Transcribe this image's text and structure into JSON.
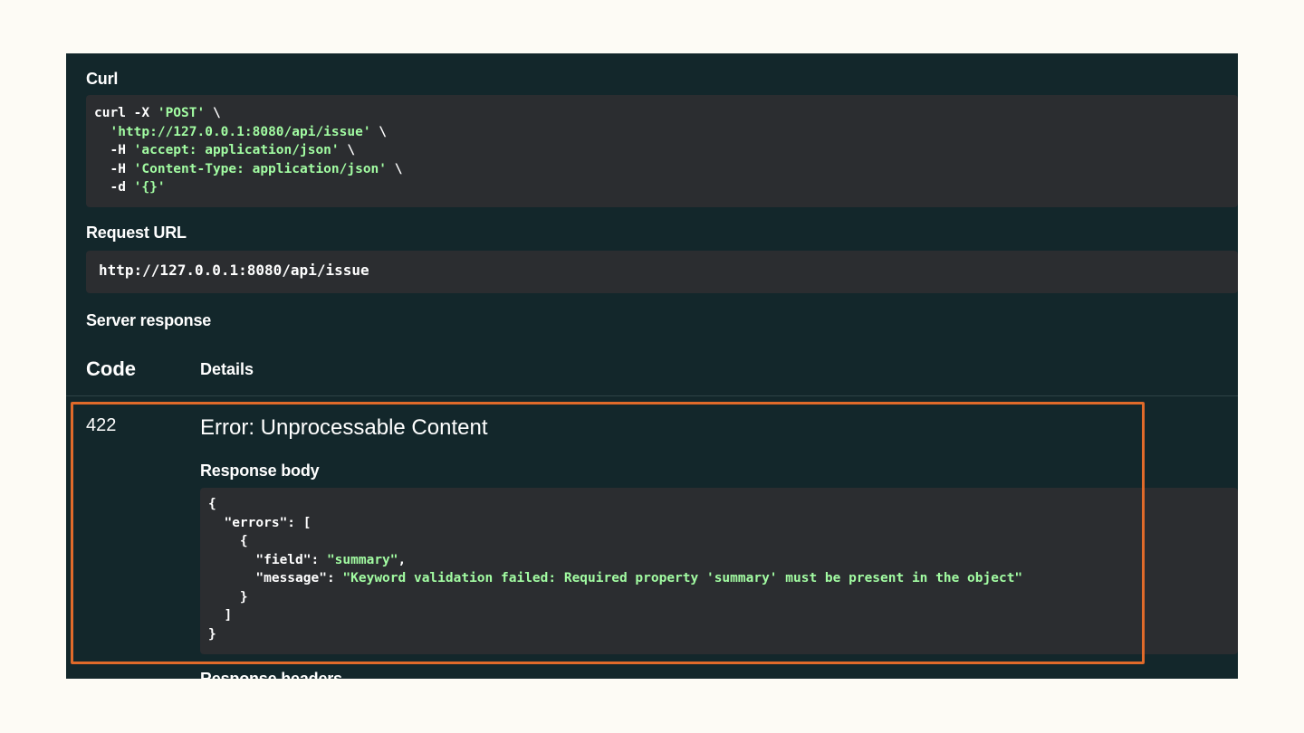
{
  "curl": {
    "label": "Curl",
    "lines": [
      [
        {
          "t": "curl -X ",
          "s": false
        },
        {
          "t": "'POST'",
          "s": true
        },
        {
          "t": " \\",
          "s": false
        }
      ],
      [
        {
          "t": "  ",
          "s": false
        },
        {
          "t": "'http://127.0.0.1:8080/api/issue'",
          "s": true
        },
        {
          "t": " \\",
          "s": false
        }
      ],
      [
        {
          "t": "  -H ",
          "s": false
        },
        {
          "t": "'accept: application/json'",
          "s": true
        },
        {
          "t": " \\",
          "s": false
        }
      ],
      [
        {
          "t": "  -H ",
          "s": false
        },
        {
          "t": "'Content-Type: application/json'",
          "s": true
        },
        {
          "t": " \\",
          "s": false
        }
      ],
      [
        {
          "t": "  -d ",
          "s": false
        },
        {
          "t": "'{}'",
          "s": true
        }
      ]
    ]
  },
  "request_url": {
    "label": "Request URL",
    "value": "http://127.0.0.1:8080/api/issue"
  },
  "server_response": {
    "label": "Server response",
    "col_code": "Code",
    "col_details": "Details",
    "code": "422",
    "title": "Error: Unprocessable Content",
    "body_label": "Response body",
    "body_lines": [
      [
        {
          "t": "{",
          "s": false
        }
      ],
      [
        {
          "t": "  \"errors\": [",
          "s": false
        }
      ],
      [
        {
          "t": "    {",
          "s": false
        }
      ],
      [
        {
          "t": "      \"field\": ",
          "s": false
        },
        {
          "t": "\"summary\"",
          "s": true
        },
        {
          "t": ",",
          "s": false
        }
      ],
      [
        {
          "t": "      \"message\": ",
          "s": false
        },
        {
          "t": "\"Keyword validation failed: Required property 'summary' must be present in the object\"",
          "s": true
        }
      ],
      [
        {
          "t": "    }",
          "s": false
        }
      ],
      [
        {
          "t": "  ]",
          "s": false
        }
      ],
      [
        {
          "t": "}",
          "s": false
        }
      ]
    ],
    "headers_label": "Response headers"
  },
  "colors": {
    "panel_bg": "#13272b",
    "code_bg": "#2b2d30",
    "string": "#a2fca2",
    "highlight": "#e06a2a"
  }
}
